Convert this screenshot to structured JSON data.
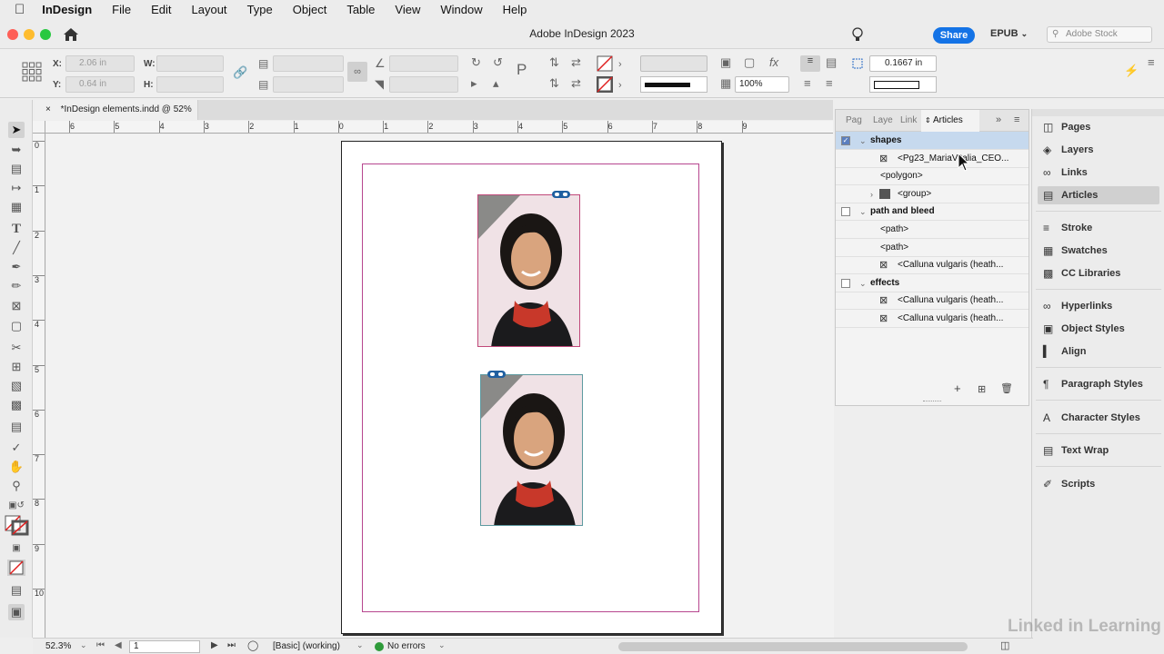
{
  "menubar": {
    "apple": "",
    "app": "InDesign",
    "items": [
      "File",
      "Edit",
      "Layout",
      "Type",
      "Object",
      "Table",
      "View",
      "Window",
      "Help"
    ]
  },
  "titlebar": {
    "title": "Adobe InDesign 2023",
    "share": "Share",
    "epub": "EPUB",
    "stock_placeholder": "Adobe Stock"
  },
  "control": {
    "x_label": "X:",
    "x_value": "2.06 in",
    "y_label": "Y:",
    "y_value": "0.64 in",
    "w_label": "W:",
    "h_label": "H:",
    "zoom_value": "100%",
    "offset_value": "0.1667 in"
  },
  "doc": {
    "tab_title": "*InDesign elements.indd @ 52%",
    "close": "×"
  },
  "ruler": {
    "h": [
      "6",
      "5",
      "4",
      "3",
      "2",
      "1",
      "0",
      "1",
      "2",
      "3",
      "4",
      "5",
      "6",
      "7",
      "8",
      "9"
    ],
    "v": [
      "0",
      "1",
      "2",
      "3",
      "4",
      "5",
      "6",
      "7",
      "8",
      "9",
      "10"
    ]
  },
  "articles_panel": {
    "tabs": [
      "Pag",
      "Laye",
      "Link",
      "Articles"
    ],
    "rows": [
      {
        "label": "shapes",
        "level": 0,
        "checked": true,
        "selected": true
      },
      {
        "label": "<Pg23_MariaVitalia_CEO...",
        "level": 2,
        "icon": "frame"
      },
      {
        "label": "<polygon>",
        "level": 1
      },
      {
        "label": "<group>",
        "level": 2,
        "icon": "group"
      },
      {
        "label": "path and bleed",
        "level": 0,
        "checked": false
      },
      {
        "label": "<path>",
        "level": 1
      },
      {
        "label": "<path>",
        "level": 1
      },
      {
        "label": "<Calluna vulgaris (heath...",
        "level": 2,
        "icon": "frame"
      },
      {
        "label": "effects",
        "level": 0,
        "checked": false
      },
      {
        "label": "<Calluna vulgaris (heath...",
        "level": 2,
        "icon": "frame"
      },
      {
        "label": "<Calluna vulgaris (heath...",
        "level": 2,
        "icon": "frame"
      }
    ]
  },
  "dock": {
    "items": [
      {
        "label": "Pages",
        "icon": "pages-icon"
      },
      {
        "label": "Layers",
        "icon": "layers-icon"
      },
      {
        "label": "Links",
        "icon": "links-icon"
      },
      {
        "label": "Articles",
        "icon": "articles-icon",
        "active": true
      },
      {
        "label": "Stroke",
        "icon": "stroke-icon"
      },
      {
        "label": "Swatches",
        "icon": "swatches-icon"
      },
      {
        "label": "CC Libraries",
        "icon": "cc-libraries-icon"
      },
      {
        "label": "Hyperlinks",
        "icon": "hyperlinks-icon"
      },
      {
        "label": "Object Styles",
        "icon": "object-styles-icon"
      },
      {
        "label": "Align",
        "icon": "align-icon"
      },
      {
        "label": "Paragraph Styles",
        "icon": "paragraph-styles-icon"
      },
      {
        "label": "Character Styles",
        "icon": "character-styles-icon"
      },
      {
        "label": "Text Wrap",
        "icon": "text-wrap-icon"
      },
      {
        "label": "Scripts",
        "icon": "scripts-icon"
      }
    ]
  },
  "status": {
    "zoom": "52.3%",
    "page": "1",
    "style": "[Basic] (working)",
    "errors": "No errors"
  },
  "watermark": "Linked in Learning",
  "colors": {
    "share": "#1473e6",
    "margin": "#b7468f",
    "no_errors": "#2e9b3a",
    "scarf": "#c8382a"
  }
}
